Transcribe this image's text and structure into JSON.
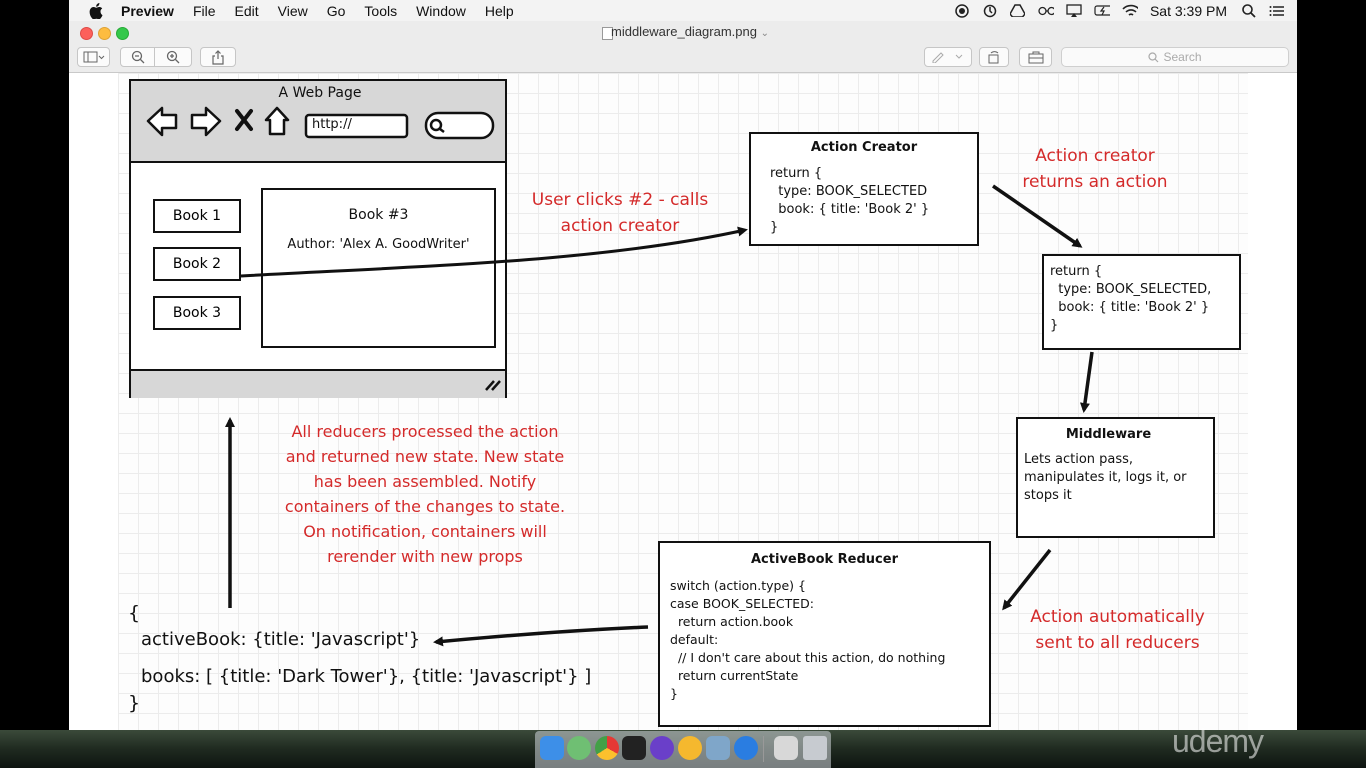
{
  "menubar": {
    "app_name": "Preview",
    "items": [
      "File",
      "Edit",
      "View",
      "Go",
      "Tools",
      "Window",
      "Help"
    ],
    "clock": "Sat 3:39 PM"
  },
  "window": {
    "title": "middleware_diagram.png",
    "search_placeholder": "Search"
  },
  "diagram": {
    "webpage": {
      "title": "A Web Page",
      "url": "http://",
      "books": [
        "Book 1",
        "Book 2",
        "Book 3"
      ],
      "detail_title": "Book #3",
      "detail_author": "Author: 'Alex A. GoodWriter'"
    },
    "action_creator": {
      "title": "Action Creator",
      "code": [
        "return {",
        "  type: BOOK_SELECTED",
        "  book: { title: 'Book 2' }",
        "}"
      ]
    },
    "action_object": {
      "code": [
        "return {",
        "  type: BOOK_SELECTED,",
        "  book: { title: 'Book 2' }",
        "}"
      ]
    },
    "middleware": {
      "title": "Middleware",
      "desc": [
        "Lets action pass,",
        "manipulates it, logs it, or",
        "stops it"
      ]
    },
    "reducer": {
      "title": "ActiveBook Reducer",
      "code": [
        "switch (action.type) {",
        "case BOOK_SELECTED:",
        "  return action.book",
        "default:",
        "  // I don't care about this action, do nothing",
        "  return currentState",
        "}"
      ]
    },
    "state": {
      "open": "{",
      "line1": "activeBook: {title: 'Javascript'}",
      "line2": "books: [ {title: 'Dark Tower'}, {title: 'Javascript'} ]",
      "close": "}"
    },
    "notes": {
      "user_clicks": [
        "User clicks #2 - calls",
        "action creator"
      ],
      "returns_action": [
        "Action creator",
        "returns an action"
      ],
      "sent_to_reducers": [
        "Action automatically",
        "sent to all reducers"
      ],
      "reducers_processed": [
        "All reducers processed the action",
        "and returned new state.  New state",
        "has been assembled.  Notify",
        "containers of the changes to state.",
        "On notification, containers will",
        "rerender with new props"
      ]
    }
  },
  "watermark": "udemy",
  "colors": {
    "note_red": "#d42a2a",
    "header_gray": "#d7d7d7"
  }
}
